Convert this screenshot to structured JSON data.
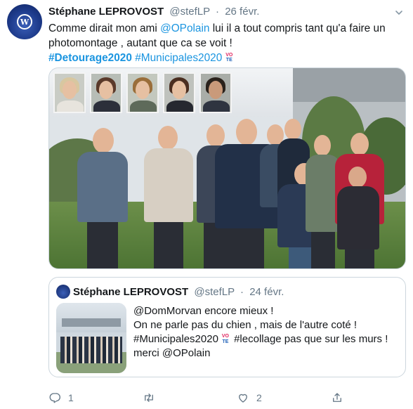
{
  "tweet": {
    "author_name": "Stéphane LEPROVOST",
    "author_handle": "@stefLP",
    "separator": "·",
    "date": "26 févr.",
    "text_part1": "Comme dirait mon ami ",
    "mention": "@OPolain",
    "text_part2": " lui il a tout compris tant qu'a faire un photomontage , autant que ca se voit  !",
    "hashtag1": "#Detourage2020",
    "hashtag2": "#Municipales2020",
    "vote_emoji": {
      "line1": "VO",
      "line2": "TE"
    },
    "media_alt_icon": "group-photo-image"
  },
  "quoted_tweet": {
    "author_name": "Stéphane LEPROVOST",
    "author_handle": "@stefLP",
    "separator": "·",
    "date": "24 févr.",
    "line1_mention": "@DomMorvan",
    "line1_rest": " encore mieux  !",
    "line2": "On ne parle pas du  chien  , mais de l'autre coté !",
    "line3_hashtag": "#Municipales2020",
    "line3_rest": " #lecollage pas que sur les murs !",
    "line4_prefix": "merci  ",
    "line4_mention": "@OPolain"
  },
  "actions": {
    "reply_count": "1",
    "retweet_count": "",
    "like_count": "2",
    "icons": [
      "reply-icon",
      "retweet-icon",
      "like-icon",
      "share-icon"
    ]
  },
  "colors": {
    "link": "#1b95e0",
    "secondary_text": "#657786",
    "border": "#ccd6dd"
  }
}
